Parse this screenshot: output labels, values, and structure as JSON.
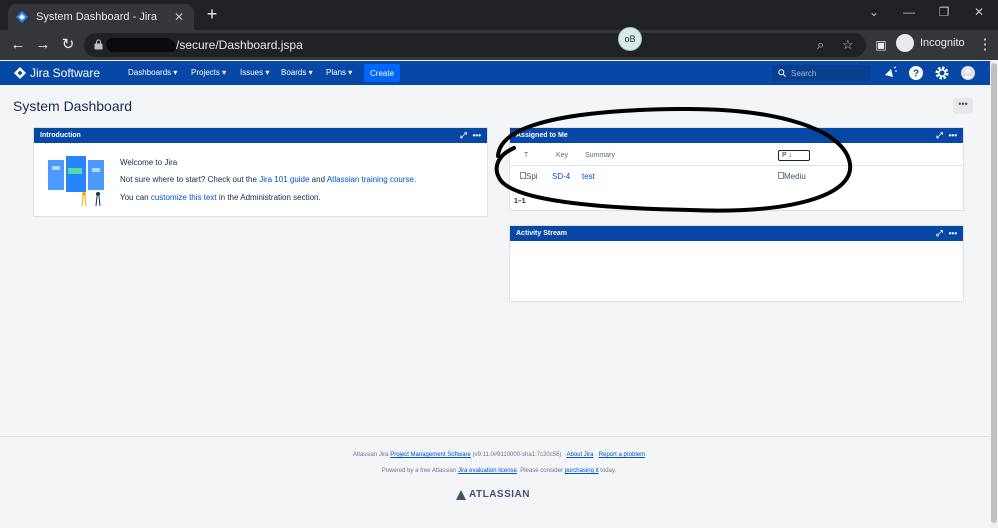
{
  "browser": {
    "tab_title": "System Dashboard - Jira",
    "url_path": "/secure/Dashboard.jspa",
    "profile_label": "Incognito",
    "chip_label": "oB"
  },
  "jira": {
    "product": "Jira Software",
    "menu": [
      "Dashboards",
      "Projects",
      "Issues",
      "Boards",
      "Plans"
    ],
    "create_label": "Create",
    "search_placeholder": "Search",
    "page_title": "System Dashboard",
    "more_label": "•••"
  },
  "introduction": {
    "title": "Introduction",
    "welcome": "Welcome to Jira",
    "line2_prefix": "Not sure where to start? Check out the ",
    "line2_link1": "Jira 101 guide",
    "line2_mid": " and ",
    "line2_link2": "Atlassian training course",
    "line2_suffix": ".",
    "line3_prefix": "You can ",
    "line3_link": "customize this text",
    "line3_suffix": " in the Administration section."
  },
  "assigned": {
    "title": "Assigned to Me",
    "columns": [
      "T",
      "Key",
      "Summary",
      "P"
    ],
    "sort_arrow": "↓",
    "rows": [
      {
        "type": "Spi",
        "key": "SD-4",
        "summary": "test",
        "priority": "Mediu"
      }
    ],
    "count_text": "1–1"
  },
  "activity": {
    "title": "Activity Stream"
  },
  "footer": {
    "line1_prefix": "Atlassian Jira ",
    "line1_link": "Project Management Software",
    "line1_version": " (v9.11.0#9110000-sha1:7c20c56)",
    "line1_sep": " · ",
    "about": "About Jira",
    "report": "Report a problem",
    "line2_prefix": "Powered by a free Atlassian ",
    "line2_link": "Jira evaluation license",
    "line2_mid": ". Please consider ",
    "line2_link2": "purchasing it",
    "line2_suffix": " today.",
    "brand": "ATLASSIAN"
  },
  "colors": {
    "header": "#0747a6",
    "accent": "#0052cc",
    "create": "#0065ff"
  }
}
